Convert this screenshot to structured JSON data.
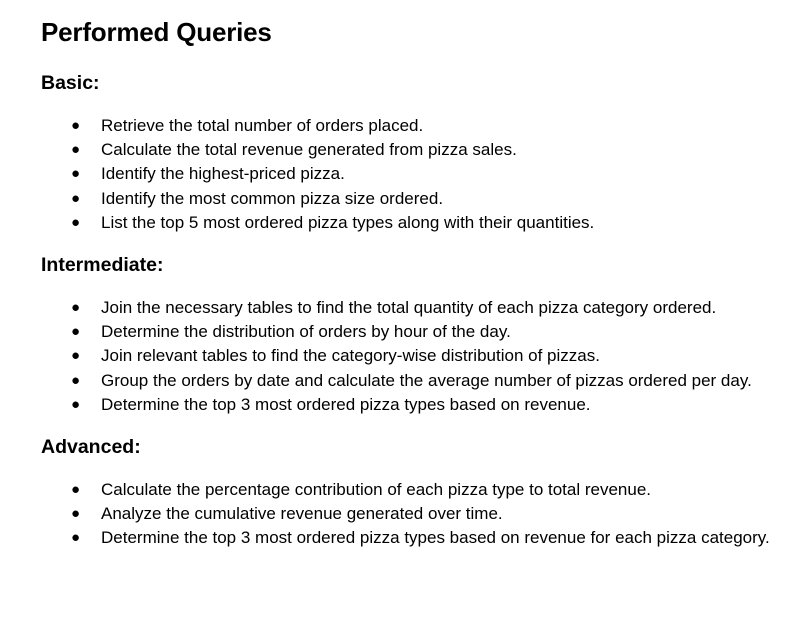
{
  "title": "Performed Queries",
  "sections": [
    {
      "heading": "Basic:",
      "items": [
        "Retrieve the total number of orders placed.",
        "Calculate the total revenue generated from pizza sales.",
        "Identify the highest-priced pizza.",
        "Identify the most common pizza size ordered.",
        "List the top 5 most ordered pizza types along with their quantities."
      ]
    },
    {
      "heading": "Intermediate:",
      "items": [
        "Join the necessary tables to find the total quantity of each pizza category ordered.",
        "Determine the distribution of orders by hour of the day.",
        "Join relevant tables to find the category-wise distribution of pizzas.",
        "Group the orders by date and calculate the average number of pizzas ordered per day.",
        "Determine the top 3 most ordered pizza types based on revenue."
      ]
    },
    {
      "heading": "Advanced:",
      "items": [
        "Calculate the percentage contribution of each pizza type to total revenue.",
        "Analyze the cumulative revenue generated over time.",
        "Determine the top 3 most ordered pizza types based on revenue for each pizza category."
      ]
    }
  ],
  "bullet_glyph": "●"
}
